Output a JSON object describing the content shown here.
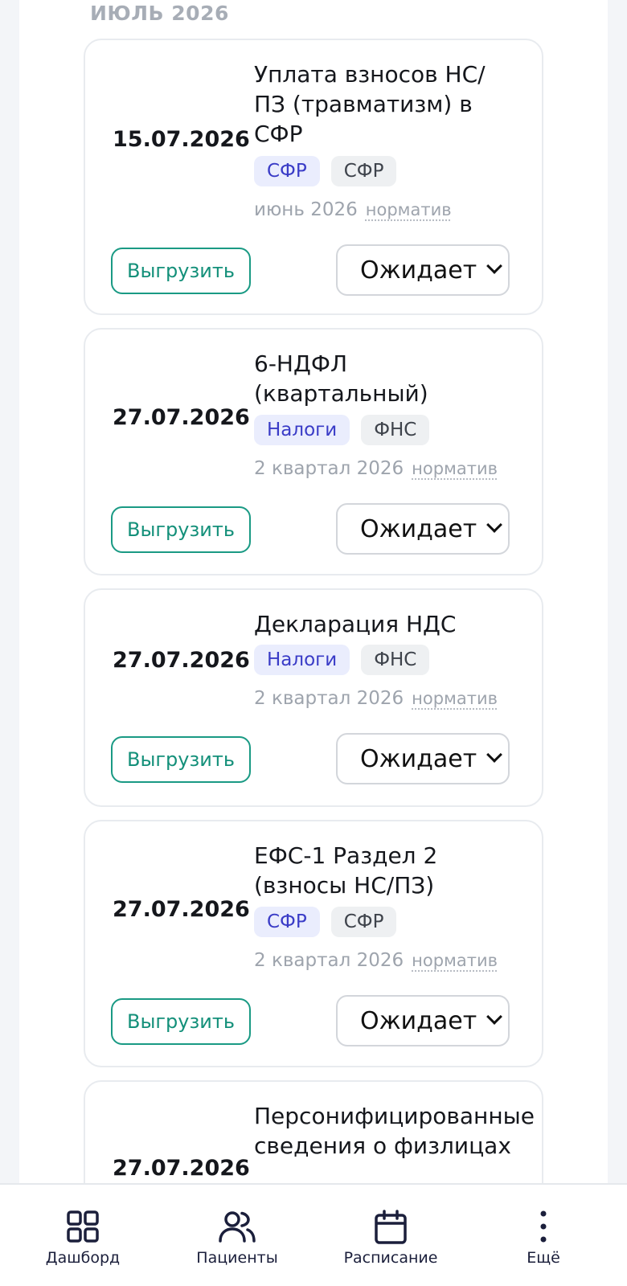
{
  "month_heading": "ИЮЛЬ 2026",
  "cards": [
    {
      "date": "15.07.2026",
      "title": "Уплата взносов НС/\nПЗ (травматизм) в\nСФР",
      "tag_category": "СФР",
      "tag_org": "СФР",
      "period": "июнь 2026",
      "norm": "норматив",
      "export_label": "Выгрузить",
      "status": "Ожидает"
    },
    {
      "date": "27.07.2026",
      "title": "6-НДФЛ\n(квартальный)",
      "tag_category": "Налоги",
      "tag_org": "ФНС",
      "period": "2 квартал 2026",
      "norm": "норматив",
      "export_label": "Выгрузить",
      "status": "Ожидает"
    },
    {
      "date": "27.07.2026",
      "title": "Декларация НДС",
      "tag_category": "Налоги",
      "tag_org": "ФНС",
      "period": "2 квартал 2026",
      "norm": "норматив",
      "export_label": "Выгрузить",
      "status": "Ожидает"
    },
    {
      "date": "27.07.2026",
      "title": "ЕФС-1 Раздел 2\n(взносы НС/ПЗ)",
      "tag_category": "СФР",
      "tag_org": "СФР",
      "period": "2 квартал 2026",
      "norm": "норматив",
      "export_label": "Выгрузить",
      "status": "Ожидает"
    },
    {
      "date": "27.07.2026",
      "title": "Персонифицированные\nсведения о физлицах"
    }
  ],
  "nav": {
    "dashboard": "Дашборд",
    "patients": "Пациенты",
    "schedule": "Расписание",
    "more": "Ещё"
  },
  "colors": {
    "accent": "#1a9a84",
    "tag_category_bg": "#eaedfd",
    "tag_category_text": "#3a3cc7",
    "tag_org_bg": "#eef0f2"
  }
}
